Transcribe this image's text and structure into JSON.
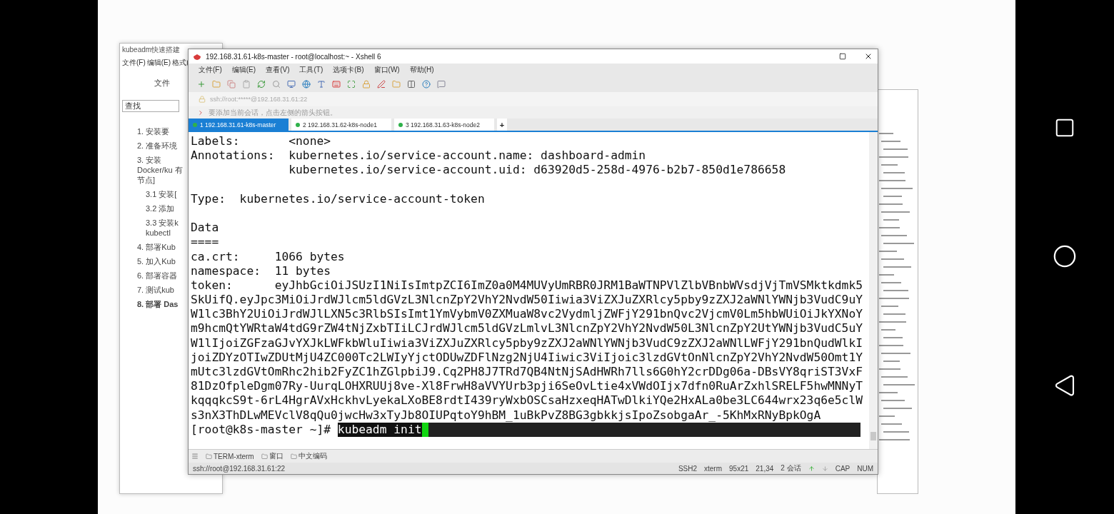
{
  "doc_window": {
    "title": "kubeadm快速搭建",
    "menu": [
      "文件(F)",
      "编辑(E)",
      "格式("
    ],
    "ribbon_tab": "文件",
    "search": {
      "placeholder": "查找"
    },
    "outline": [
      {
        "label": "1. 安装要",
        "selected": false
      },
      {
        "label": "2. 准备环境",
        "selected": false
      },
      {
        "label": "3. 安装 Docker/ku 有节点]",
        "selected": false,
        "children": [
          {
            "label": "3.1 安装[",
            "selected": false
          },
          {
            "label": "3.2 添加",
            "selected": false
          },
          {
            "label": "3.3 安装k kubectl",
            "selected": false
          }
        ]
      },
      {
        "label": "4. 部署Kub",
        "selected": false
      },
      {
        "label": "5. 加入Kub",
        "selected": false
      },
      {
        "label": "6. 部署容器",
        "selected": false
      },
      {
        "label": "7. 测试kub",
        "selected": false
      },
      {
        "label": "8. 部署 Das",
        "selected": true
      }
    ]
  },
  "xshell": {
    "title": "192.168.31.61-k8s-master - root@localhost:~ - Xshell 6",
    "menu": [
      "文件(F)",
      "编辑(E)",
      "查看(V)",
      "工具(T)",
      "选项卡(B)",
      "窗口(W)",
      "帮助(H)"
    ],
    "address": "ssh://root:*****@192.168.31.61:22",
    "hint": "要添加当前会话，点击左侧的箭头按钮。",
    "tabs": [
      {
        "label": "1 192.168.31.61-k8s-master",
        "selected": true
      },
      {
        "label": "2 192.168.31.62-k8s-node1",
        "selected": false
      },
      {
        "label": "3 192.168.31.63-k8s-node2",
        "selected": false
      }
    ],
    "new_tab": "+",
    "terminal": {
      "lines": [
        {
          "kind": "text",
          "text": "Labels:       <none>"
        },
        {
          "kind": "text",
          "text": "Annotations:  kubernetes.io/service-account.name: dashboard-admin"
        },
        {
          "kind": "text",
          "text": "              kubernetes.io/service-account.uid: d63920d5-258d-4976-b2b7-850d1e786658"
        },
        {
          "kind": "blank"
        },
        {
          "kind": "text",
          "text": "Type:  kubernetes.io/service-account-token"
        },
        {
          "kind": "blank"
        },
        {
          "kind": "text",
          "text": "Data"
        },
        {
          "kind": "text",
          "text": "===="
        },
        {
          "kind": "text",
          "text": "ca.crt:     1066 bytes"
        },
        {
          "kind": "text",
          "text": "namespace:  11 bytes"
        },
        {
          "kind": "text",
          "text": "token:      eyJhbGciOiJSUzI1NiIsImtpZCI6ImZ0a0M4MUVyUmRBR0JRM1BaWTNPVlZlbVBnbWVsdjVjTmVSMktkdmk5"
        },
        {
          "kind": "text",
          "text": "SkUifQ.eyJpc3MiOiJrdWJlcm5ldGVzL3NlcnZpY2VhY2NvdW50Iiwia3ViZXJuZXRlcy5pby9zZXJ2aWNlYWNjb3VudC9uY"
        },
        {
          "kind": "text",
          "text": "W1lc3BhY2UiOiJrdWJlLXN5c3RlbSIsImt1YmVybmV0ZXMuaW8vc2VydmljZWFjY291bnQvc2VjcmV0Lm5hbWUiOiJkYXNoY"
        },
        {
          "kind": "text",
          "text": "m9hcmQtYWRtaW4tdG9rZW4tNjZxbTIiLCJrdWJlcm5ldGVzLmlvL3NlcnZpY2VhY2NvdW50L3NlcnZpY2UtYWNjb3VudC5uY"
        },
        {
          "kind": "text",
          "text": "W1lIjoiZGFzaGJvYXJkLWFkbWluIiwia3ViZXJuZXRlcy5pby9zZXJ2aWNlYWNjb3VudC9zZXJ2aWNlLWFjY291bnQudWlkI"
        },
        {
          "kind": "text",
          "text": "joiZDYzOTIwZDUtMjU4ZC000Tc2LWIyYjctODUwZDFlNzg2NjU4Iiwic3ViIjoic3lzdGVtOnNlcnZpY2VhY2NvdW50Omt1Y"
        },
        {
          "kind": "text",
          "text": "mUtc3lzdGVtOmRhc2hib2FyZC1hZGlpbiJ9.Cq2PH8J7TRd7QB4NtNjSAdHWRh7lls6G0hY2crDDg06a-DBsVY8qriST3VxF"
        },
        {
          "kind": "text",
          "text": "81DzOfpleDgm07Ry-UurqLOHXRUUj8ve-Xl8FrwH8aVVYUrb3pji6SeOvLtie4xVWdOIjx7dfn0RuArZxhlSRELF5hwMNNyT"
        },
        {
          "kind": "text",
          "text": "kqqqkcS9t-6rL4HgrAVxHckhvLyekaLXoBE8rdtI439ryWxbOSCsaHzxeqHATwDlkiYQe2HxALa0be3LC644wrx23q6e5clW"
        },
        {
          "kind": "text",
          "text": "s3nX3ThDLwMEVclV8qQu0jwcHw3xTyJb8OIUPqtoY9hBM_1uBkPvZ8BG3gbkkjsIpoZsobgaAr_-5KhMxRNyBpkOgA"
        }
      ],
      "prompt": "[root@k8s-master ~]# ",
      "selection": "kubeadm init"
    },
    "quick_bar": [
      "TERM-xterm",
      "窗口",
      "中文编码"
    ],
    "status": {
      "path": "ssh://root@192.168.31.61:22",
      "items": [
        "SSH2",
        "xterm",
        "95x21",
        "21,34",
        "2 会话",
        "CAP",
        "NUM"
      ]
    }
  }
}
